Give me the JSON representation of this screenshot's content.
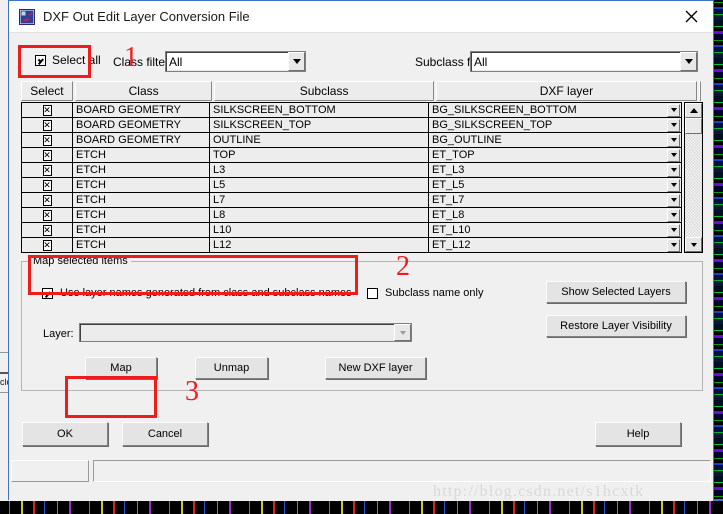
{
  "window": {
    "title": "DXF Out Edit Layer Conversion File",
    "icon": "allegro-dxf-icon",
    "close_label": "✕"
  },
  "filters": {
    "select_all_label": "Select all",
    "select_all_checked": true,
    "class_filter_label": "Class filter:",
    "class_filter_value": "All",
    "subclass_filter_label": "Subclass filter:",
    "subclass_filter_value": "All"
  },
  "table": {
    "columns": [
      "Select",
      "Class",
      "Subclass",
      "DXF layer"
    ],
    "rows": [
      {
        "select": "☒",
        "class": "BOARD GEOMETRY",
        "subclass": "SILKSCREEN_BOTTOM",
        "dxf": "BG_SILKSCREEN_BOTTOM"
      },
      {
        "select": "☒",
        "class": "BOARD GEOMETRY",
        "subclass": "SILKSCREEN_TOP",
        "dxf": "BG_SILKSCREEN_TOP"
      },
      {
        "select": "☒",
        "class": "BOARD GEOMETRY",
        "subclass": "OUTLINE",
        "dxf": "BG_OUTLINE"
      },
      {
        "select": "☒",
        "class": "ETCH",
        "subclass": "TOP",
        "dxf": "ET_TOP"
      },
      {
        "select": "☒",
        "class": "ETCH",
        "subclass": "L3",
        "dxf": "ET_L3"
      },
      {
        "select": "☒",
        "class": "ETCH",
        "subclass": "L5",
        "dxf": "ET_L5"
      },
      {
        "select": "☒",
        "class": "ETCH",
        "subclass": "L7",
        "dxf": "ET_L7"
      },
      {
        "select": "☒",
        "class": "ETCH",
        "subclass": "L8",
        "dxf": "ET_L8"
      },
      {
        "select": "☒",
        "class": "ETCH",
        "subclass": "L10",
        "dxf": "ET_L10"
      },
      {
        "select": "☒",
        "class": "ETCH",
        "subclass": "L12",
        "dxf": "ET_L12"
      }
    ]
  },
  "map_group": {
    "title": "Map selected items",
    "use_layer_names_label": "Use layer names generated from class and subclass names",
    "use_layer_names_checked": true,
    "subclass_only_label": "Subclass name only",
    "subclass_only_checked": false,
    "layer_label": "Layer:",
    "layer_value": "",
    "map_label": "Map",
    "unmap_label": "Unmap",
    "new_dxf_layer_label": "New DXF layer",
    "show_selected_layers_label": "Show Selected Layers",
    "restore_layer_visibility_label": "Restore Layer Visibility"
  },
  "footer": {
    "ok_label": "OK",
    "cancel_label": "Cancel",
    "help_label": "Help"
  },
  "annotations": {
    "marker_1": "1",
    "marker_2": "2",
    "marker_3": "3",
    "color": "#ee1c1c"
  },
  "background": {
    "left_panel_text": "clo",
    "watermark": "http://blog.csdn.net/s1hcxtk"
  }
}
